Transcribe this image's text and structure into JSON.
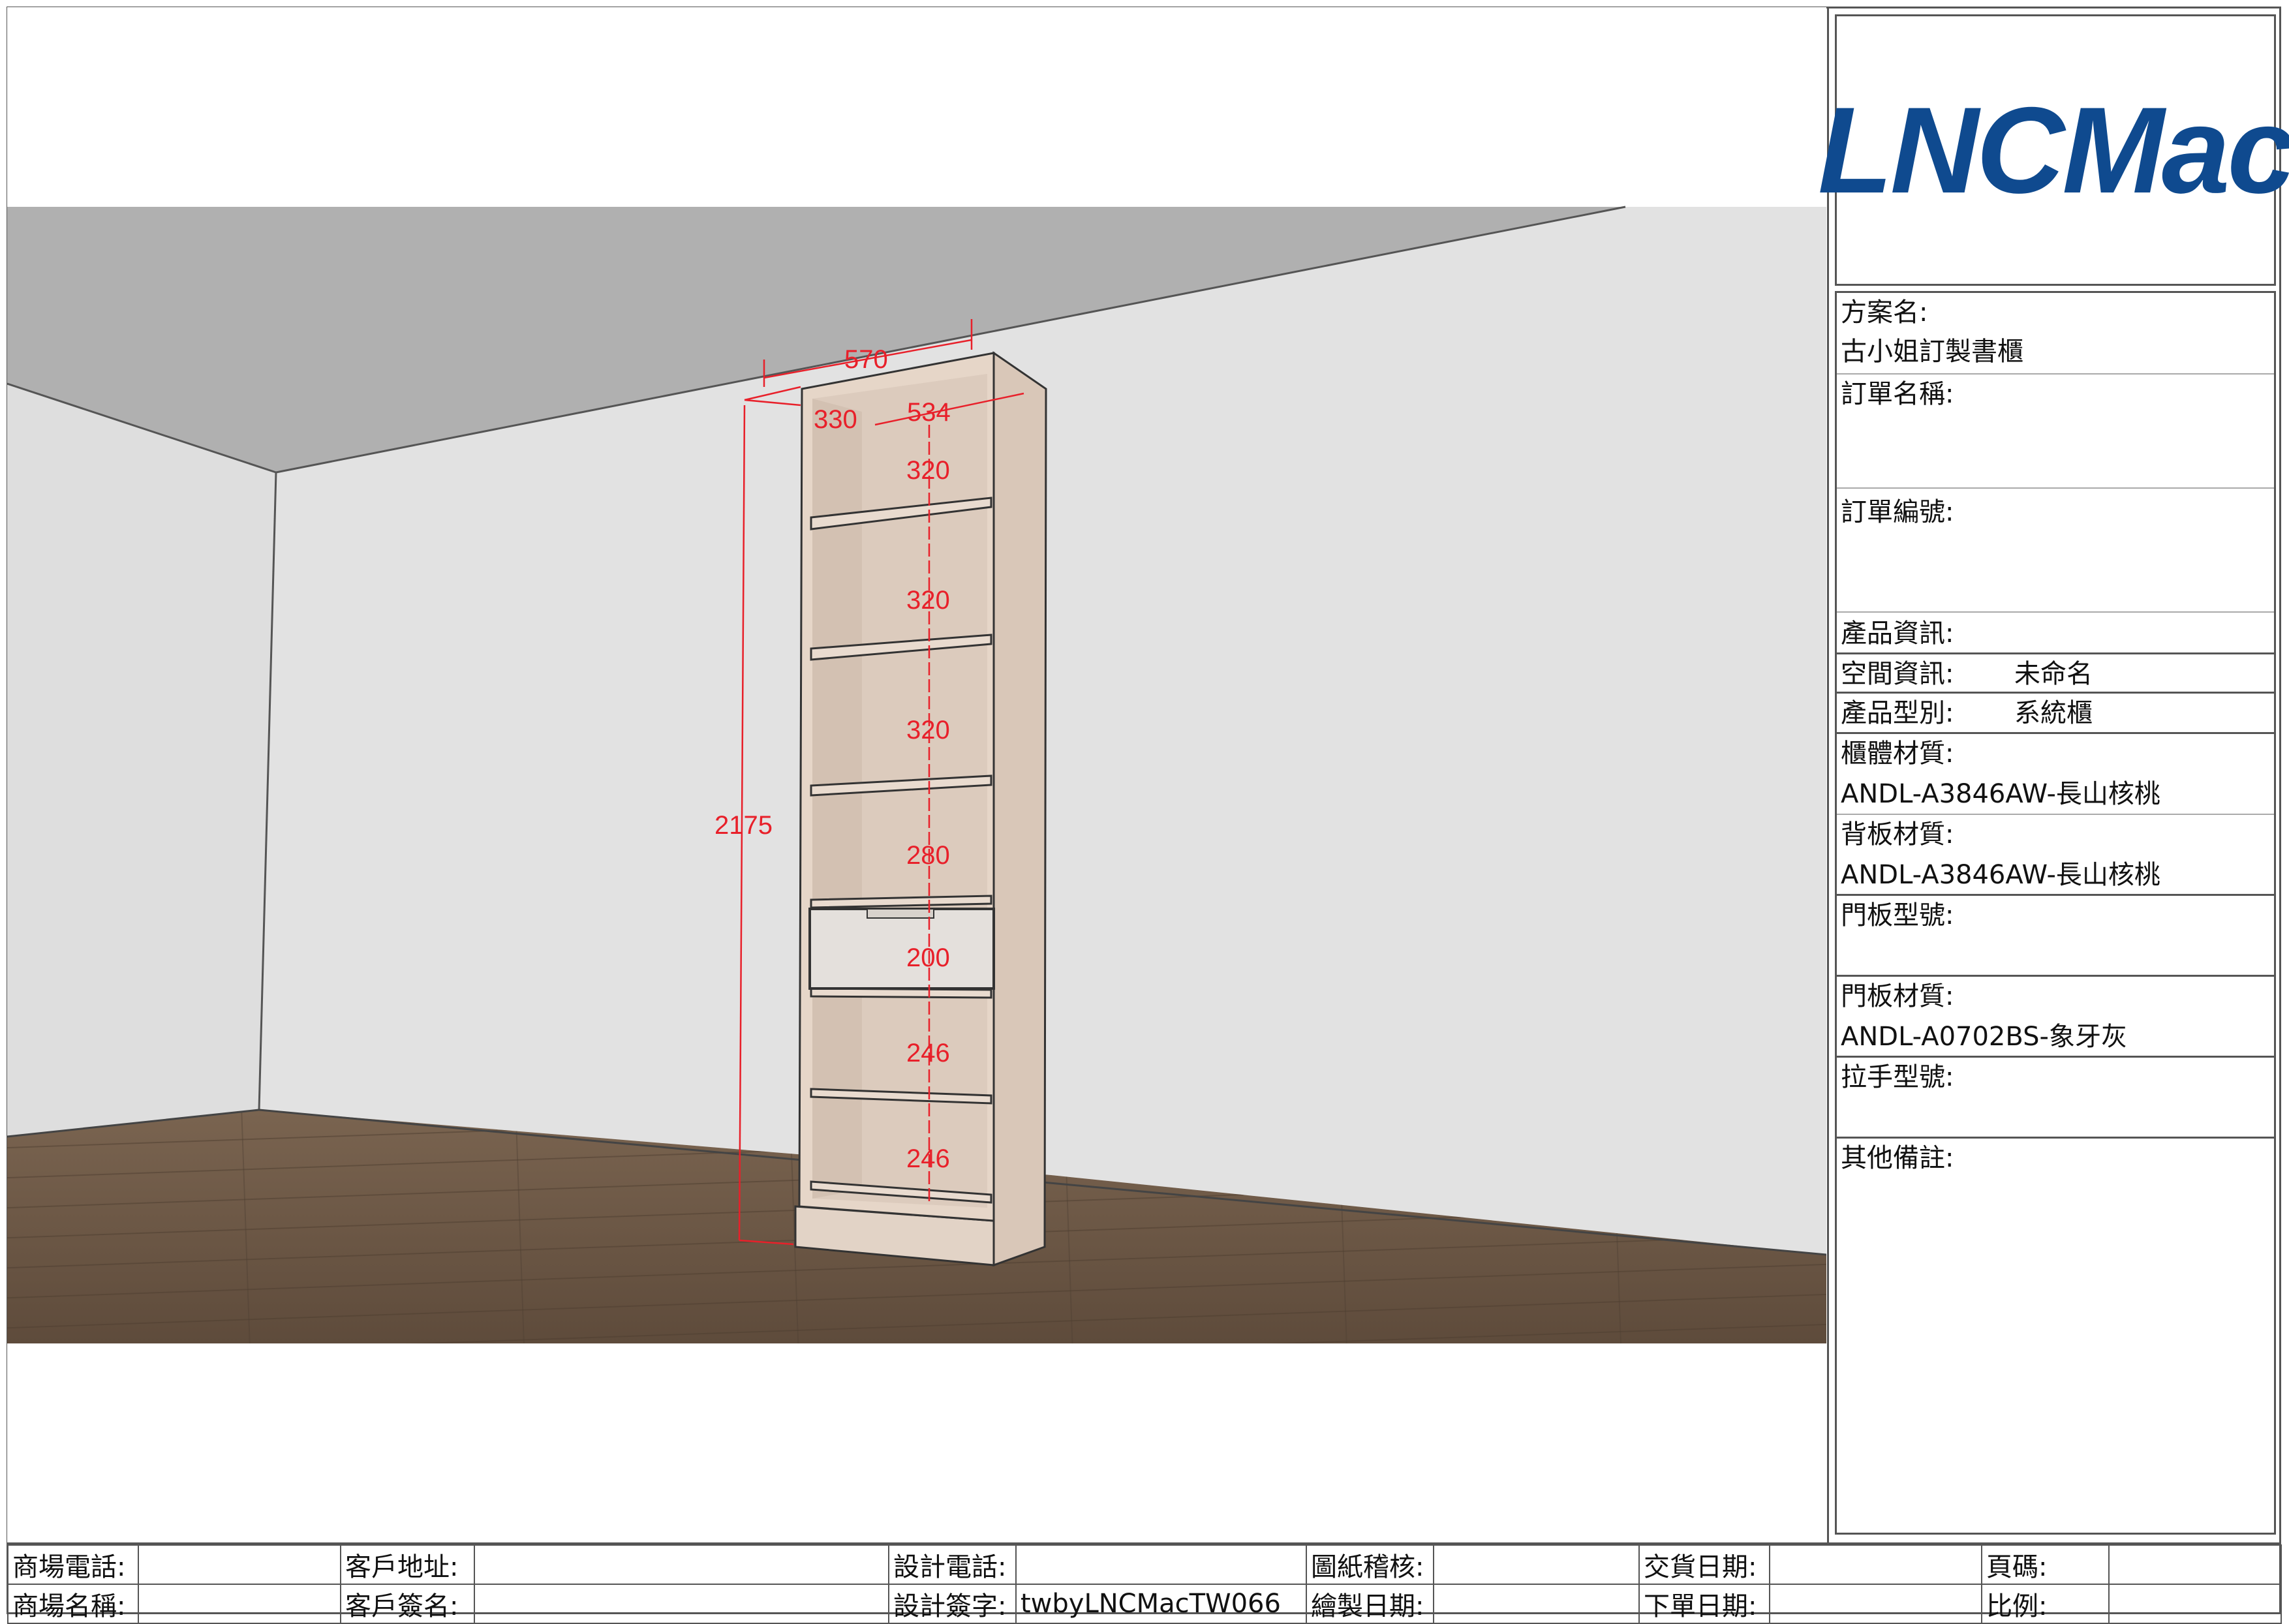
{
  "brand": {
    "logo_text": "LNCMac",
    "logo_color": "#0f4a8f"
  },
  "drawing": {
    "dimensions": {
      "width": "570",
      "depth": "330",
      "inner_width": "534",
      "height": "2175",
      "compartments": [
        "320",
        "320",
        "320",
        "280",
        "200",
        "246",
        "246"
      ]
    },
    "colors": {
      "dimension": "#e8202a",
      "wood": "#e6d6c8",
      "door": "#e4e0dc",
      "floor": "#6f5a48",
      "wall": "#e2e2e2",
      "ceiling": "#b0b0b0"
    }
  },
  "info": {
    "project_label": "方案名:",
    "project_value": "古小姐訂製書櫃",
    "order_name_label": "訂單名稱:",
    "order_no_label": "訂單編號:",
    "product_info_label": "產品資訊:",
    "space_label": "空間資訊:",
    "space_value": "未命名",
    "type_label": "產品型別:",
    "type_value": "系統櫃",
    "body_material_label": "櫃體材質:",
    "body_material_value": "ANDL-A3846AW-長山核桃",
    "back_material_label": "背板材質:",
    "back_material_value": "ANDL-A3846AW-長山核桃",
    "door_model_label": "門板型號:",
    "door_material_label": "門板材質:",
    "door_material_value": "ANDL-A0702BS-象牙灰",
    "handle_label": "拉手型號:",
    "notes_label": "其他備註:"
  },
  "footer": {
    "row1": [
      "商場電話:",
      "",
      "客戶地址:",
      "",
      "設計電話:",
      "",
      "圖紙稽核:",
      "",
      "交貨日期:",
      "",
      "頁碼:",
      ""
    ],
    "row2": [
      "商場名稱:",
      "",
      "客戶簽名:",
      "",
      "設計簽字:",
      "twbyLNCMacTW066",
      "繪製日期:",
      "",
      "下單日期:",
      "",
      "比例:",
      ""
    ]
  }
}
